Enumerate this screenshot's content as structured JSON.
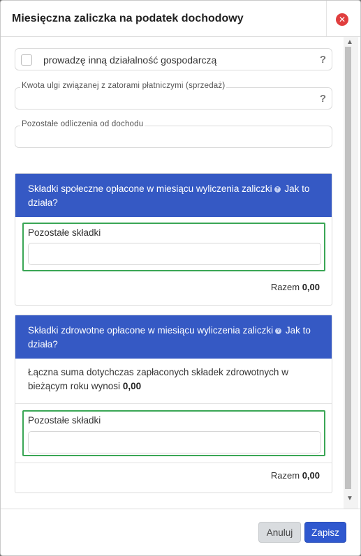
{
  "modal": {
    "title": "Miesięczna zaliczka na podatek dochodowy",
    "close_icon": "close-circle-icon"
  },
  "form": {
    "checkbox_label": "prowadzę inną działalność gospodarczą",
    "help_mark": "?",
    "relief_label": "Kwota ulgi związanej z zatorami płatniczymi (sprzedaż)",
    "relief_value": "",
    "other_deductions_label": "Pozostałe odliczenia od dochodu",
    "other_deductions_value": ""
  },
  "social_panel": {
    "heading": "Składki społeczne opłacone w miesiącu wyliczenia zaliczki",
    "info_icon": "info-icon",
    "link": "Jak to działa?",
    "field_label": "Pozostałe składki",
    "field_value": "",
    "total_label": "Razem",
    "total_value": "0,00"
  },
  "health_panel": {
    "heading": "Składki zdrowotne opłacone w miesiącu wyliczenia zaliczki",
    "info_icon": "info-icon",
    "link": "Jak to działa?",
    "info_text": "Łączna suma dotychczas zapłaconych składek zdrowotnych w bieżącym roku wynosi",
    "info_value": "0,00",
    "field_label": "Pozostałe składki",
    "field_value": "",
    "total_label": "Razem",
    "total_value": "0,00"
  },
  "footer": {
    "cancel_label": "Anuluj",
    "save_label": "Zapisz"
  },
  "colors": {
    "accent": "#2f58cf",
    "panel_header": "#3559c4",
    "highlight": "#3aa655",
    "close": "#e03e3e"
  }
}
